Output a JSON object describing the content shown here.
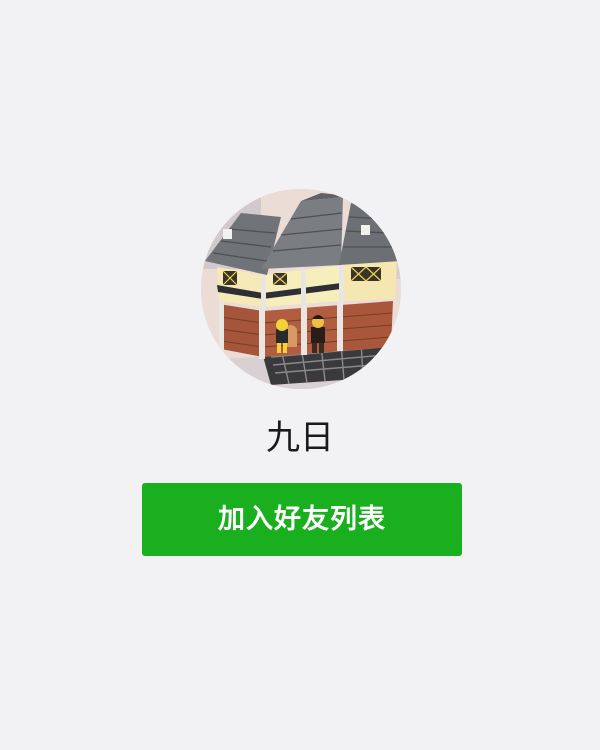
{
  "profile": {
    "name": "九日",
    "avatar_subject": "lego-house-illustration"
  },
  "actions": {
    "add_friend_label": "加入好友列表"
  },
  "colors": {
    "background": "#f2f1f4",
    "button": "#1aaf1f",
    "button_text": "#ffffff",
    "name_text": "#1a1a1a"
  }
}
